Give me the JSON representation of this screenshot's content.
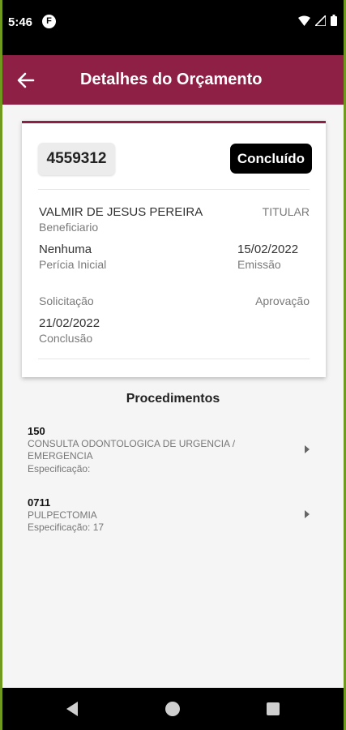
{
  "status_bar": {
    "time": "5:46",
    "app_icon_letter": "F",
    "icons": [
      "wifi-icon",
      "cell-signal-icon",
      "battery-icon"
    ]
  },
  "app_bar": {
    "title": "Detalhes do Orçamento",
    "back_icon": "arrow-left-icon",
    "color": "#8e1f45"
  },
  "budget": {
    "code": "4559312",
    "status": "Concluído",
    "beneficiary": {
      "value": "VALMIR DE JESUS PEREIRA",
      "label": "Beneficiario"
    },
    "holder_type": "TITULAR",
    "initial_expertise": {
      "value": "Nenhuma",
      "label": "Perícia Inicial"
    },
    "issue": {
      "value": "15/02/2022",
      "label": "Emissão"
    },
    "request_label": "Solicitação",
    "approval_label": "Aprovação",
    "conclusion": {
      "value": "21/02/2022",
      "label": "Conclusão"
    }
  },
  "procedures": {
    "title": "Procedimentos",
    "items": [
      {
        "code": "150",
        "name": "CONSULTA ODONTOLOGICA DE URGENCIA / EMERGENCIA",
        "spec": "Especificação:"
      },
      {
        "code": "0711",
        "name": "PULPECTOMIA",
        "spec": "Especificação: 17"
      }
    ]
  },
  "nav_bar": {
    "icons": [
      "nav-back-icon",
      "nav-home-icon",
      "nav-recents-icon"
    ]
  }
}
